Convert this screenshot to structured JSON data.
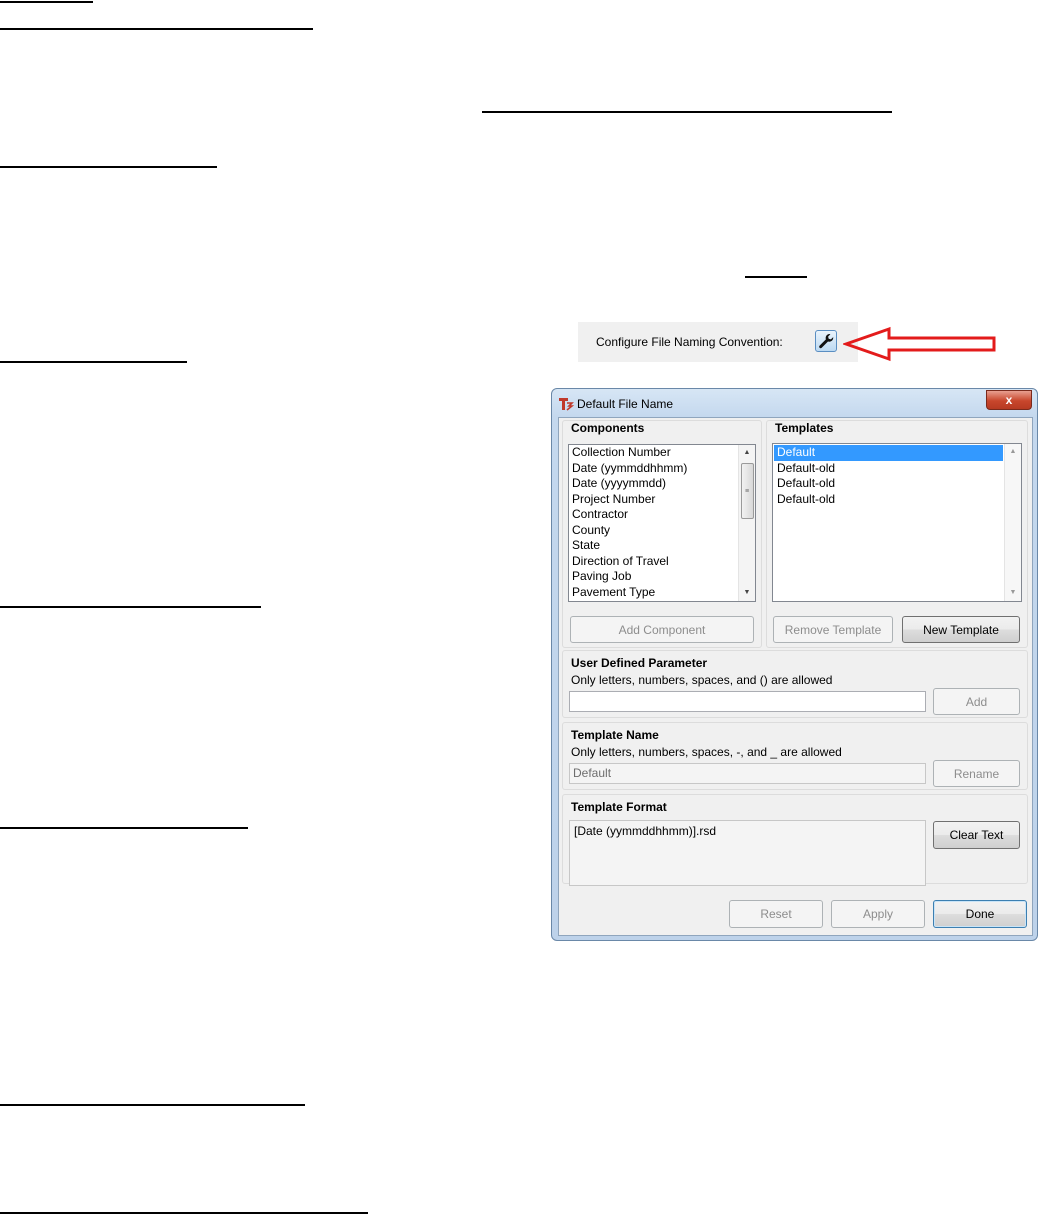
{
  "config": {
    "label": "Configure File Naming Convention:",
    "icon": "wrench-icon",
    "arrow_color": "#e31b1b"
  },
  "dialog": {
    "title": "Default File Name",
    "close_label": "x",
    "components": {
      "title": "Components",
      "items": [
        "Collection Number",
        "Date (yymmddhhmm)",
        "Date (yyyymmdd)",
        "Project Number",
        "Contractor",
        "County",
        "State",
        "Direction of Travel",
        "Paving Job",
        "Pavement Type"
      ]
    },
    "templates": {
      "title": "Templates",
      "items": [
        "Default",
        "Default-old",
        "Default-old",
        "Default-old"
      ],
      "selected": "Default"
    },
    "buttons": {
      "add_component": "Add Component",
      "remove_template": "Remove Template",
      "new_template": "New Template",
      "add": "Add",
      "rename": "Rename",
      "clear_text": "Clear Text",
      "reset": "Reset",
      "apply": "Apply",
      "done": "Done"
    },
    "user_defined": {
      "title": "User Defined Parameter",
      "hint": "Only letters, numbers, spaces, and () are allowed",
      "value": ""
    },
    "template_name": {
      "title": "Template Name",
      "hint": "Only letters, numbers, spaces, -, and _ are allowed",
      "value": "Default"
    },
    "template_format": {
      "title": "Template Format",
      "value": "[Date (yymmddhhmm)].rsd"
    },
    "selection_color": "#3399ff"
  }
}
